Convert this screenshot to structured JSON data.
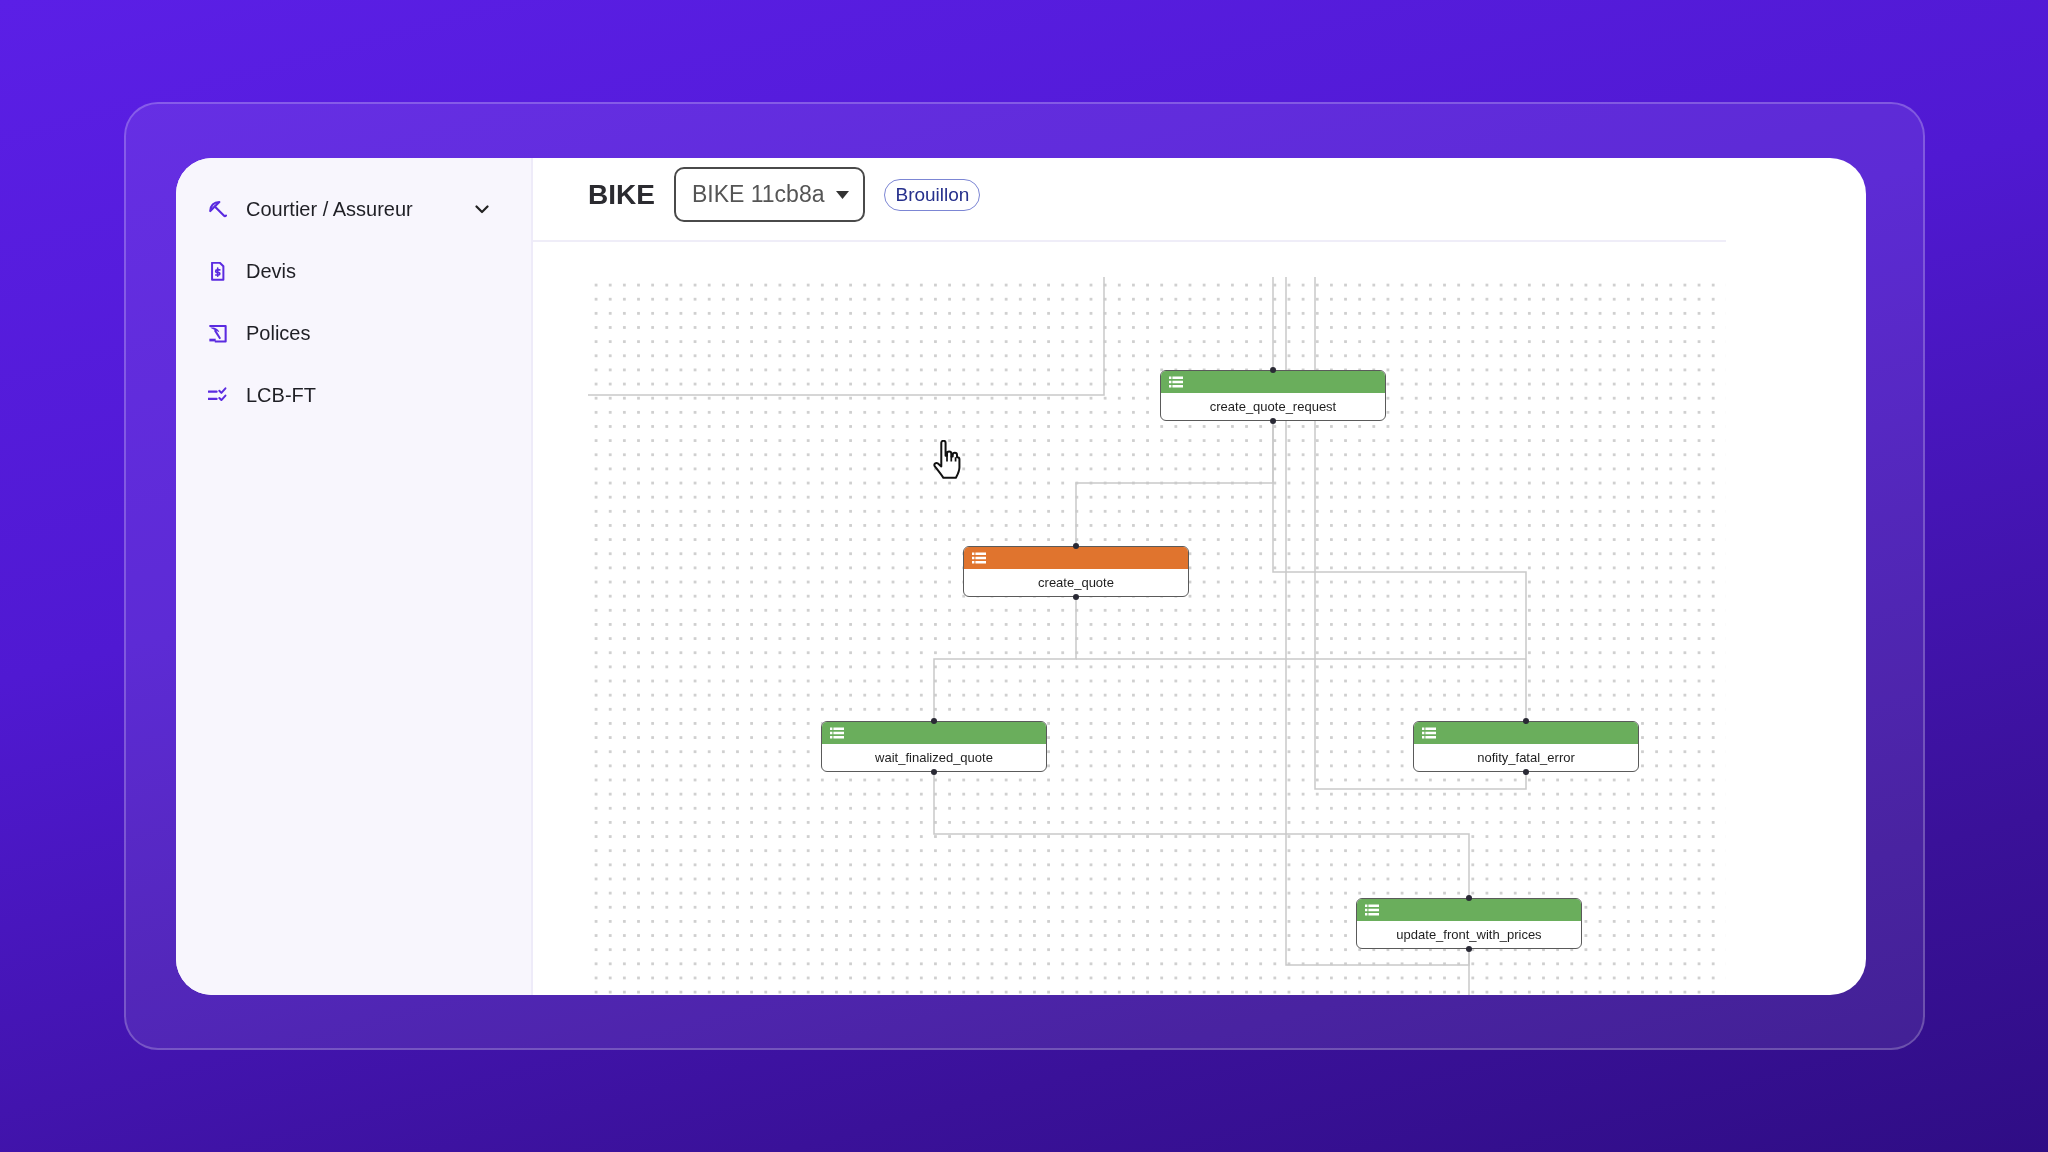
{
  "sidebar": {
    "items": [
      {
        "label": "Courtier / Assureur",
        "kind": "group",
        "expanded": false,
        "selected": false
      },
      {
        "label": "Devis",
        "kind": "link",
        "selected": false
      },
      {
        "label": "Polices",
        "kind": "link",
        "selected": false
      },
      {
        "label": "LCB-FT",
        "kind": "link",
        "selected": false
      }
    ]
  },
  "header": {
    "title": "BIKE",
    "version_select": {
      "value": "BIKE 11cb8a"
    },
    "status_badge": "Brouillon"
  },
  "workflow": {
    "nodes": [
      {
        "label": "create_quote_request",
        "color": "#6aae5c"
      },
      {
        "label": "create_quote",
        "color": "#e0742e"
      },
      {
        "label": "wait_finalized_quote",
        "color": "#6aae5c"
      },
      {
        "label": "nofity_fatal_error",
        "color": "#6aae5c"
      },
      {
        "label": "update_front_with_prices",
        "color": "#6aae5c"
      }
    ]
  }
}
